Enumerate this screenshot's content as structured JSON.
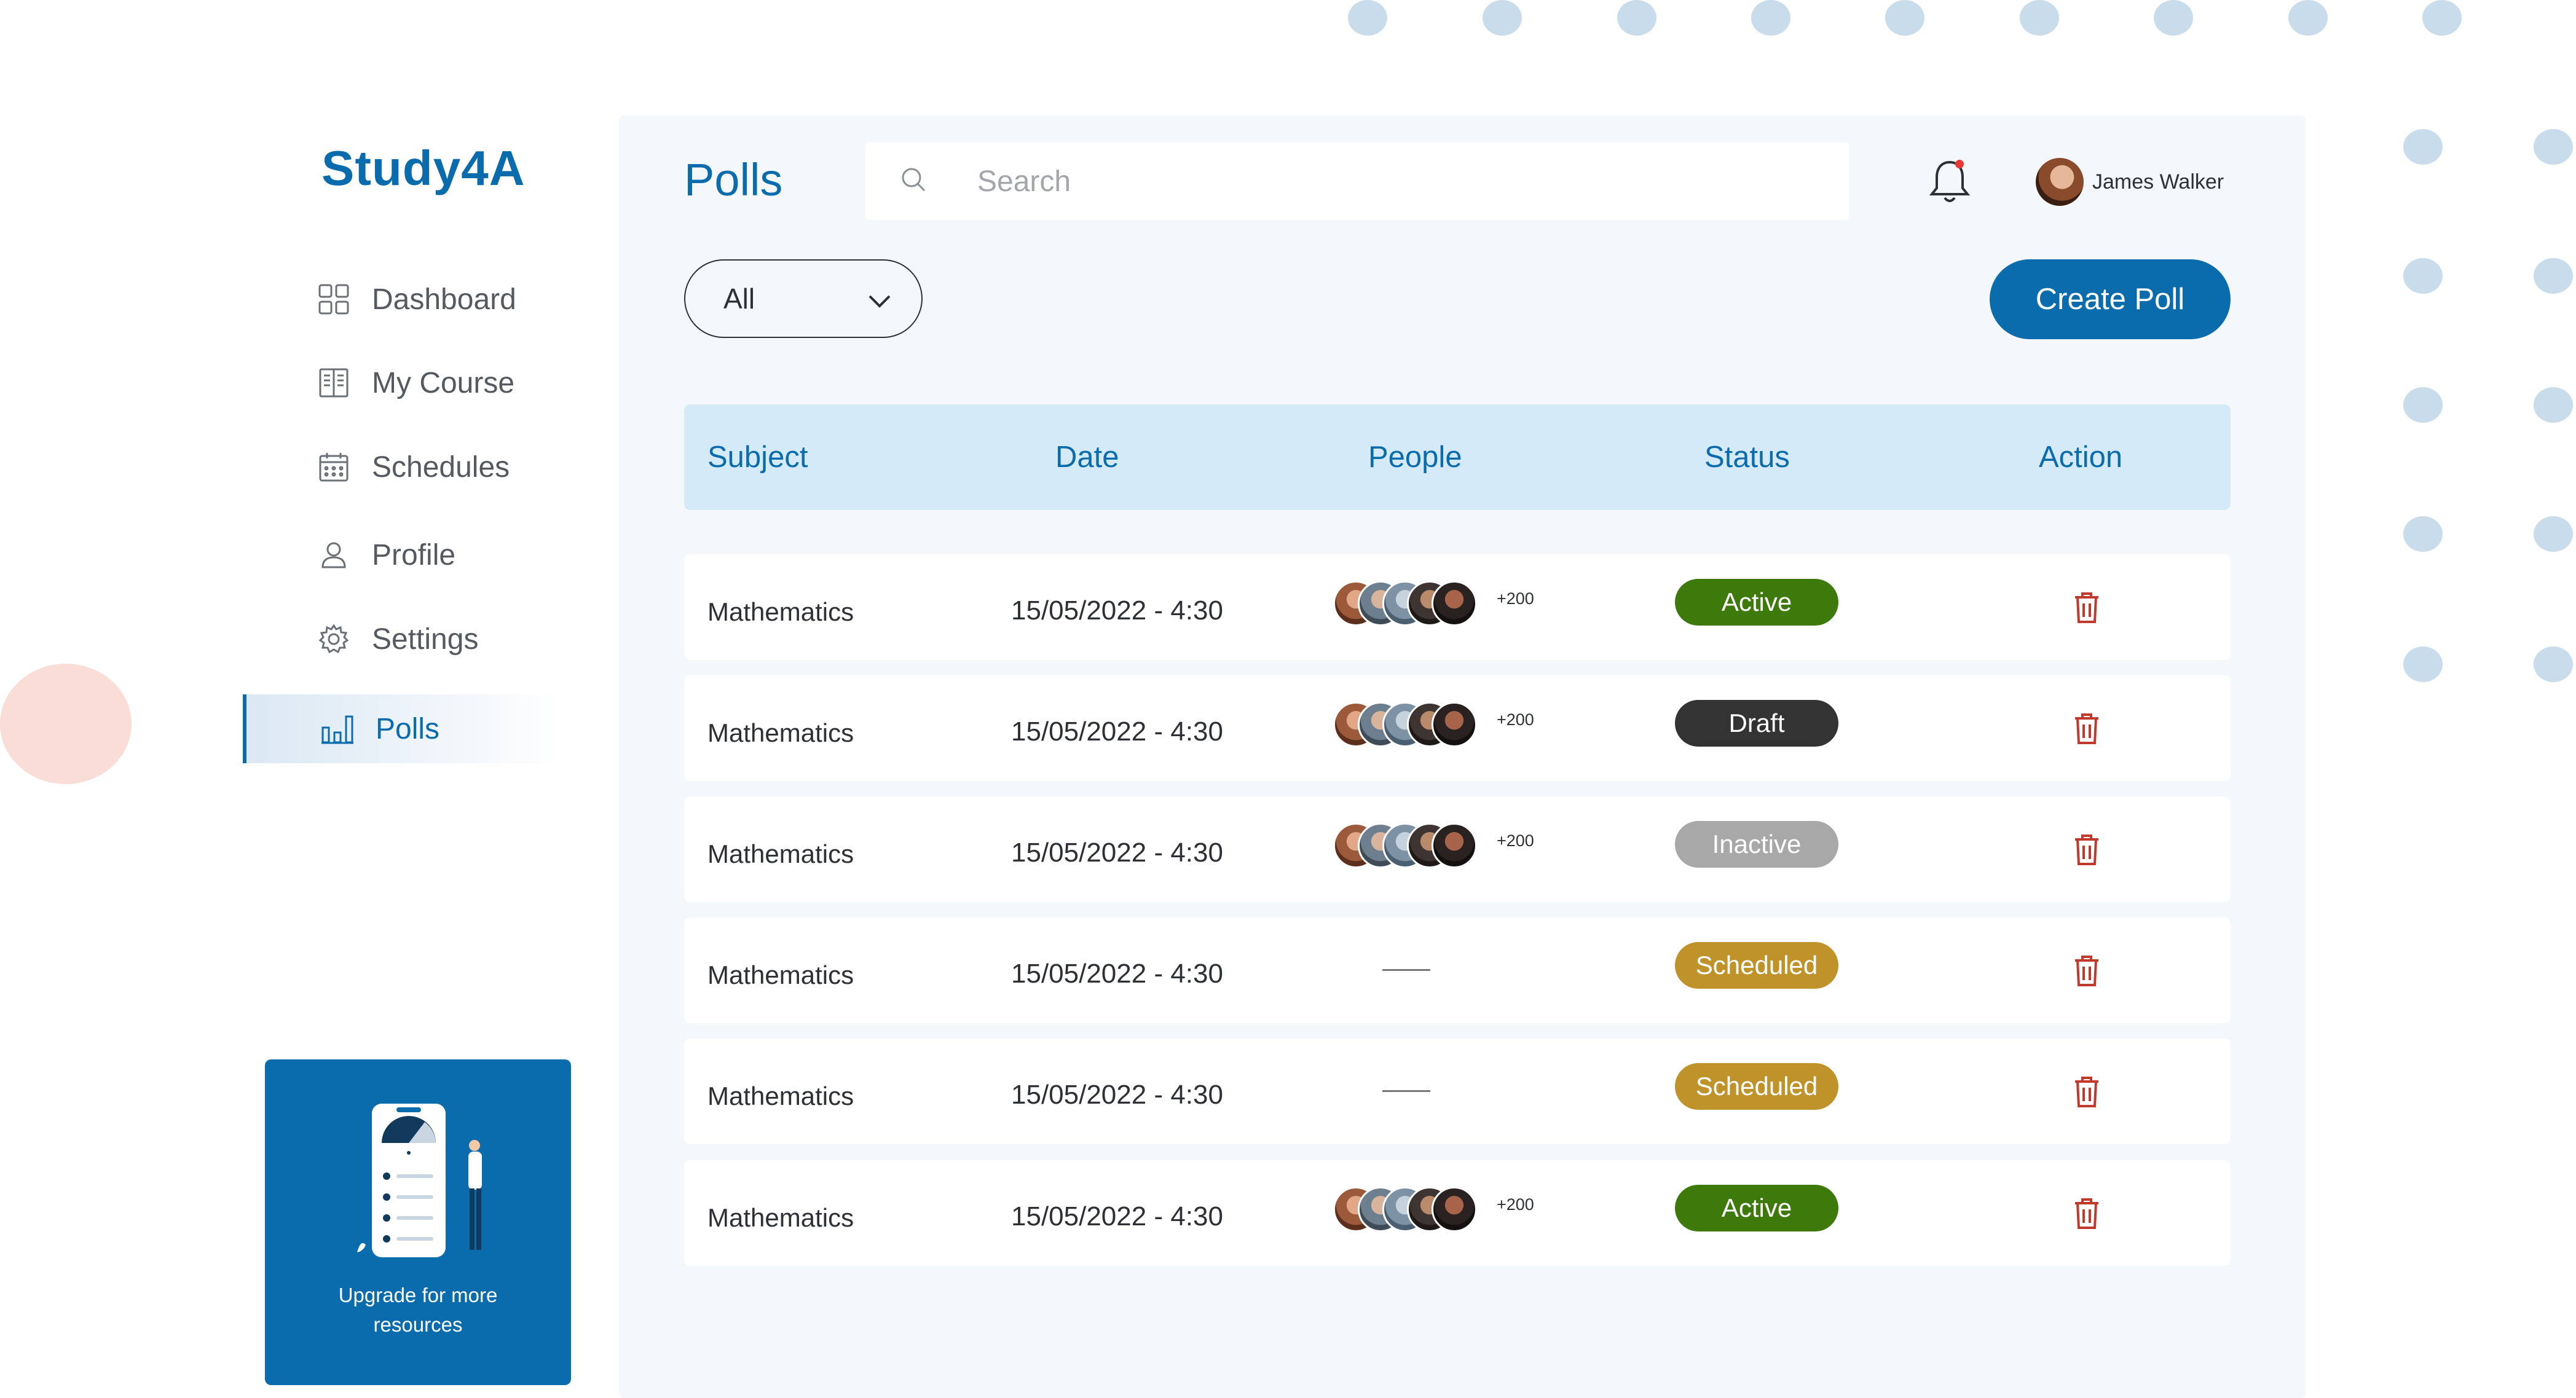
{
  "app": {
    "brand": "Study4A"
  },
  "sidebar": {
    "items": [
      {
        "label": "Dashboard",
        "icon": "grid-icon"
      },
      {
        "label": "My Course",
        "icon": "book-icon"
      },
      {
        "label": "Schedules",
        "icon": "calendar-icon"
      },
      {
        "label": "Profile",
        "icon": "user-icon"
      },
      {
        "label": "Settings",
        "icon": "gear-icon"
      },
      {
        "label": "Polls",
        "icon": "bar-chart-icon",
        "active": true
      }
    ],
    "upgrade": {
      "line1": "Upgrade for more",
      "line2": "resources"
    }
  },
  "header": {
    "title": "Polls",
    "search": {
      "placeholder": "Search",
      "value": ""
    },
    "user": {
      "name": "James Walker"
    },
    "notification_dot_color": "#e53935"
  },
  "toolbar": {
    "filter": {
      "selected": "All"
    },
    "create_label": "Create Poll"
  },
  "table": {
    "columns": [
      "Subject",
      "Date",
      "People",
      "Status",
      "Action"
    ],
    "rows": [
      {
        "subject": "Mathematics",
        "date": "15/05/2022 - 4:30",
        "people": "+200",
        "status": "Active"
      },
      {
        "subject": "Mathematics",
        "date": "15/05/2022 - 4:30",
        "people": "+200",
        "status": "Draft"
      },
      {
        "subject": "Mathematics",
        "date": "15/05/2022 - 4:30",
        "people": "+200",
        "status": "Inactive"
      },
      {
        "subject": "Mathematics",
        "date": "15/05/2022 - 4:30",
        "people": "",
        "status": "Scheduled"
      },
      {
        "subject": "Mathematics",
        "date": "15/05/2022 - 4:30",
        "people": "",
        "status": "Scheduled"
      },
      {
        "subject": "Mathematics",
        "date": "15/05/2022 - 4:30",
        "people": "+200",
        "status": "Active"
      }
    ]
  },
  "colors": {
    "brand": "#0b6cad",
    "active": "#3d7a0b",
    "draft": "#333333",
    "inactive": "#a8a8a8",
    "scheduled": "#c0922a",
    "trash": "#c0392b",
    "header_bg": "#d5eaf9"
  }
}
